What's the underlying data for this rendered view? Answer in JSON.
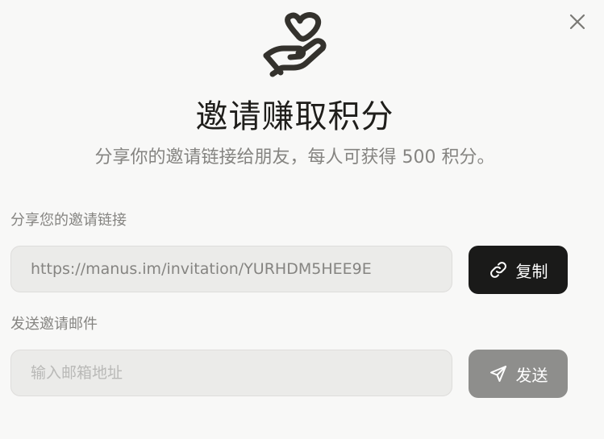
{
  "dialog": {
    "close_icon": "close-icon",
    "hero_icon": "heart-hand-icon",
    "title": "邀请赚取积分",
    "subtitle": "分享你的邀请链接给朋友，每人可获得 500 积分。"
  },
  "share_link": {
    "label": "分享您的邀请链接",
    "url": "https://manus.im/invitation/YURHDM5HEE9E",
    "copy_icon": "link-icon",
    "copy_label": "复制"
  },
  "email_invite": {
    "label": "发送邀请邮件",
    "placeholder": "输入邮箱地址",
    "value": "",
    "send_icon": "send-icon",
    "send_label": "发送"
  },
  "colors": {
    "background": "#f8f8f7",
    "copy_button": "#1a1a19",
    "send_button_disabled": "#8e8e8c",
    "field_background": "#ebebe9"
  }
}
